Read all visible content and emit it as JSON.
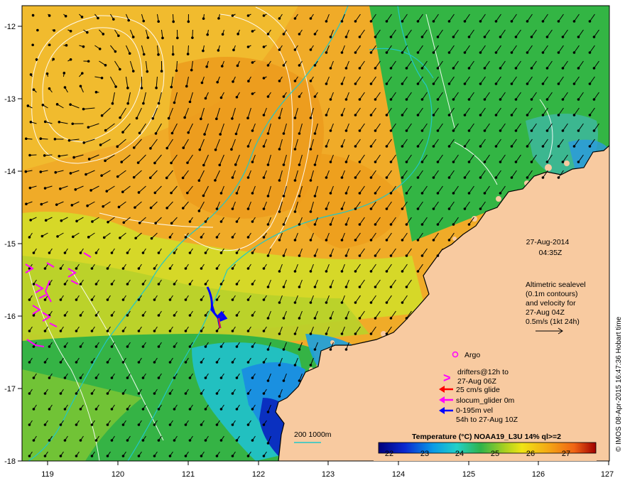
{
  "map": {
    "date": "27-Aug-2014",
    "time": "04:35Z",
    "altimetry_lines": [
      "Altimetric sealevel",
      "(0.1m contours)",
      "and velocity for",
      "27-Aug 04Z",
      "0.5m/s (1kt 24h)"
    ],
    "legend": {
      "argo": "Argo",
      "drifters_line1": "drifters@12h to",
      "drifters_line2": "27-Aug 06Z",
      "glide": "25 cm/s glide",
      "slocum": "slocum_glider 0m",
      "vel_line1": "0-195m vel",
      "vel_line2": "54h to 27-Aug 10Z",
      "argo_symbol": "o",
      "drifter_symbol": ">",
      "color_argo": "#ff00ff",
      "color_glide": "#ff0000",
      "color_slocum": "#ff00ff",
      "color_vel": "#0000ff"
    },
    "isobath_label": "200  1000m",
    "colorbar": {
      "title": "Temperature (°C) NOAA19_L3U 14% ql>=2",
      "ticks": [
        "22",
        "23",
        "24",
        "25",
        "26",
        "27"
      ]
    },
    "credit": "© IMOS 08-Apr-2015 16:47:36 Hobart time",
    "x_ticks": [
      "119",
      "120",
      "121",
      "122",
      "123",
      "124",
      "125",
      "126",
      "127"
    ],
    "y_ticks": [
      "-12",
      "-13",
      "-14",
      "-15",
      "-16",
      "-17",
      "-18"
    ],
    "colors": {
      "land": "#f8caa0",
      "warm": "#f0a020",
      "green": "#36b53a",
      "isobath": "#20c8c8"
    }
  }
}
